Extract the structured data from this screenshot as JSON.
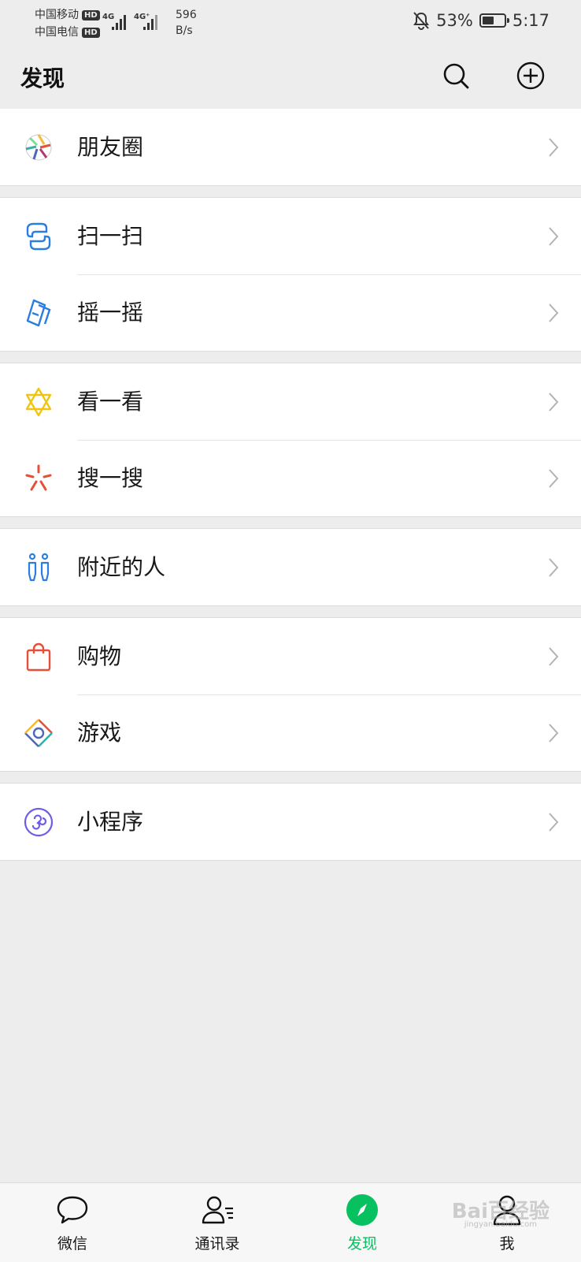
{
  "status": {
    "carrier1": "中国移动",
    "carrier2": "中国电信",
    "hd": "HD",
    "net1": "4G",
    "net2": "4G⁺",
    "speed_value": "596",
    "speed_unit": "B/s",
    "battery_percent": "53%",
    "battery_level": 0.53,
    "time": "5:17"
  },
  "header": {
    "title": "发现",
    "search_icon": "search-icon",
    "add_icon": "plus-circle-icon"
  },
  "groups": [
    {
      "items": [
        {
          "label": "朋友圈",
          "icon": "moments-icon"
        }
      ]
    },
    {
      "items": [
        {
          "label": "扫一扫",
          "icon": "scan-icon"
        },
        {
          "label": "摇一摇",
          "icon": "shake-icon"
        }
      ]
    },
    {
      "items": [
        {
          "label": "看一看",
          "icon": "top-stories-icon"
        },
        {
          "label": "搜一搜",
          "icon": "search-spark-icon"
        }
      ]
    },
    {
      "items": [
        {
          "label": "附近的人",
          "icon": "people-nearby-icon"
        }
      ]
    },
    {
      "items": [
        {
          "label": "购物",
          "icon": "shopping-bag-icon"
        },
        {
          "label": "游戏",
          "icon": "games-icon"
        }
      ]
    },
    {
      "items": [
        {
          "label": "小程序",
          "icon": "mini-programs-icon"
        }
      ]
    }
  ],
  "tabs": [
    {
      "label": "微信",
      "icon": "chat-bubble-icon"
    },
    {
      "label": "通讯录",
      "icon": "contacts-icon"
    },
    {
      "label": "发现",
      "icon": "compass-icon",
      "active": true
    },
    {
      "label": "我",
      "icon": "profile-icon"
    }
  ],
  "watermark": {
    "text": "Bai百经验",
    "sub": "jingyan.baidu.com"
  },
  "colors": {
    "accent": "#07c160",
    "background": "#ededed"
  }
}
